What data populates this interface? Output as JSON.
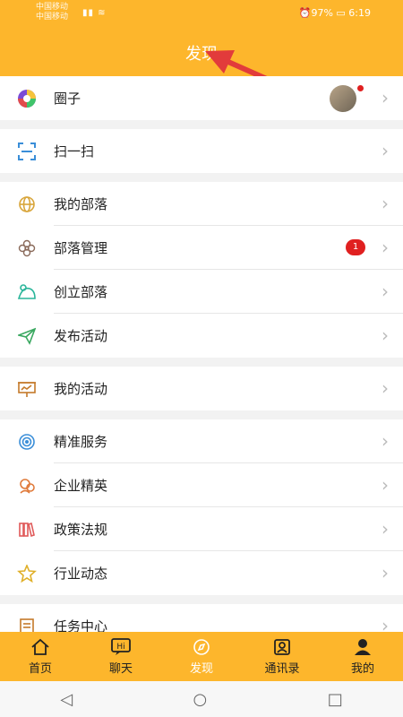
{
  "status_bar": {
    "carrier_1": "中国移动",
    "carrier_2": "中国移动",
    "signal": "▮▮ ≋",
    "right": "⏰97% ▭ 6:19"
  },
  "header": {
    "title": "发现"
  },
  "accent_color": "#fdb62c",
  "menu": {
    "circle": {
      "label": "圈子",
      "icon": "rainbow-circle-icon"
    },
    "scan": {
      "label": "扫一扫",
      "icon": "scan-icon"
    },
    "my_tribe": {
      "label": "我的部落",
      "icon": "globe-icon"
    },
    "tribe_manage": {
      "label": "部落管理",
      "icon": "flower-icon",
      "badge": "1"
    },
    "create_tribe": {
      "label": "创立部落",
      "icon": "tribe-create-icon"
    },
    "publish_activity": {
      "label": "发布活动",
      "icon": "paper-plane-icon"
    },
    "my_activity": {
      "label": "我的活动",
      "icon": "presentation-board-icon"
    },
    "precise_service": {
      "label": "精准服务",
      "icon": "target-icon"
    },
    "elite": {
      "label": "企业精英",
      "icon": "elite-icon"
    },
    "policy": {
      "label": "政策法规",
      "icon": "books-icon"
    },
    "industry_news": {
      "label": "行业动态",
      "icon": "star-face-icon"
    },
    "task_center": {
      "label": "任务中心",
      "icon": "task-icon"
    }
  },
  "tabbar": {
    "home": "首页",
    "chat": "聊天",
    "discover": "发现",
    "contacts": "通讯录",
    "mine": "我的"
  }
}
